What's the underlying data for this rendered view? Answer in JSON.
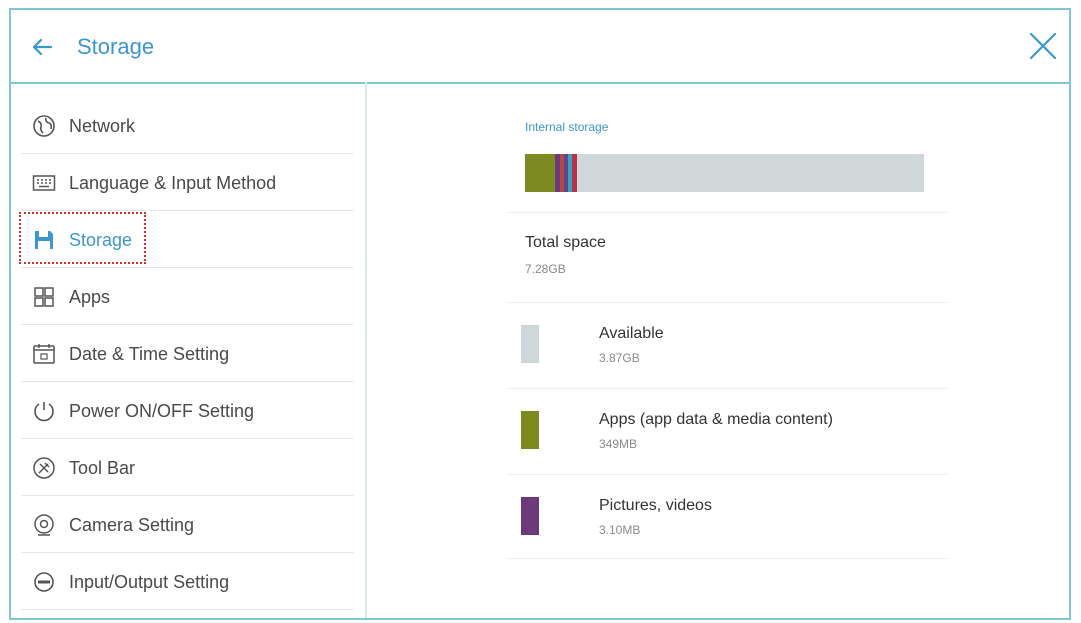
{
  "header": {
    "title": "Storage",
    "back_icon": "arrow-left-icon",
    "close_icon": "close-icon",
    "accent_color": "#3d97cf",
    "border_color": "#7fc8d3"
  },
  "sidebar": {
    "items": [
      {
        "label": "Network",
        "icon": "globe-icon",
        "active": false
      },
      {
        "label": "Language & Input Method",
        "icon": "keyboard-icon",
        "active": false
      },
      {
        "label": "Storage",
        "icon": "floppy-disk-icon",
        "active": true
      },
      {
        "label": "Apps",
        "icon": "apps-grid-icon",
        "active": false
      },
      {
        "label": "Date & Time Setting",
        "icon": "calendar-icon",
        "active": false
      },
      {
        "label": "Power ON/OFF Setting",
        "icon": "power-icon",
        "active": false
      },
      {
        "label": "Tool Bar",
        "icon": "toolbar-icon",
        "active": false
      },
      {
        "label": "Camera Setting",
        "icon": "camera-icon",
        "active": false
      },
      {
        "label": "Input/Output Setting",
        "icon": "input-output-icon",
        "active": false
      }
    ]
  },
  "storage": {
    "section_title": "Internal storage",
    "usage_bar": [
      {
        "name": "apps",
        "fraction": 0.075,
        "color": "#7d8a1f"
      },
      {
        "name": "pictures-videos",
        "fraction": 0.012,
        "color": "#6c3a7a"
      },
      {
        "name": "other-1",
        "fraction": 0.012,
        "color": "#b24a4a"
      },
      {
        "name": "other-2",
        "fraction": 0.008,
        "color": "#5a4a8a"
      },
      {
        "name": "other-3",
        "fraction": 0.012,
        "color": "#3f9fc0"
      },
      {
        "name": "other-4",
        "fraction": 0.012,
        "color": "#b8334a"
      }
    ],
    "free_color": "#cfd7d8",
    "total": {
      "label": "Total space",
      "value": "7.28GB"
    },
    "rows": [
      {
        "label": "Available",
        "value": "3.87GB",
        "color": "#cfd7d8"
      },
      {
        "label": "Apps (app data & media content)",
        "value": "349MB",
        "color": "#7d8a1f"
      },
      {
        "label": "Pictures, videos",
        "value": "3.10MB",
        "color": "#6c3a7a"
      }
    ]
  }
}
